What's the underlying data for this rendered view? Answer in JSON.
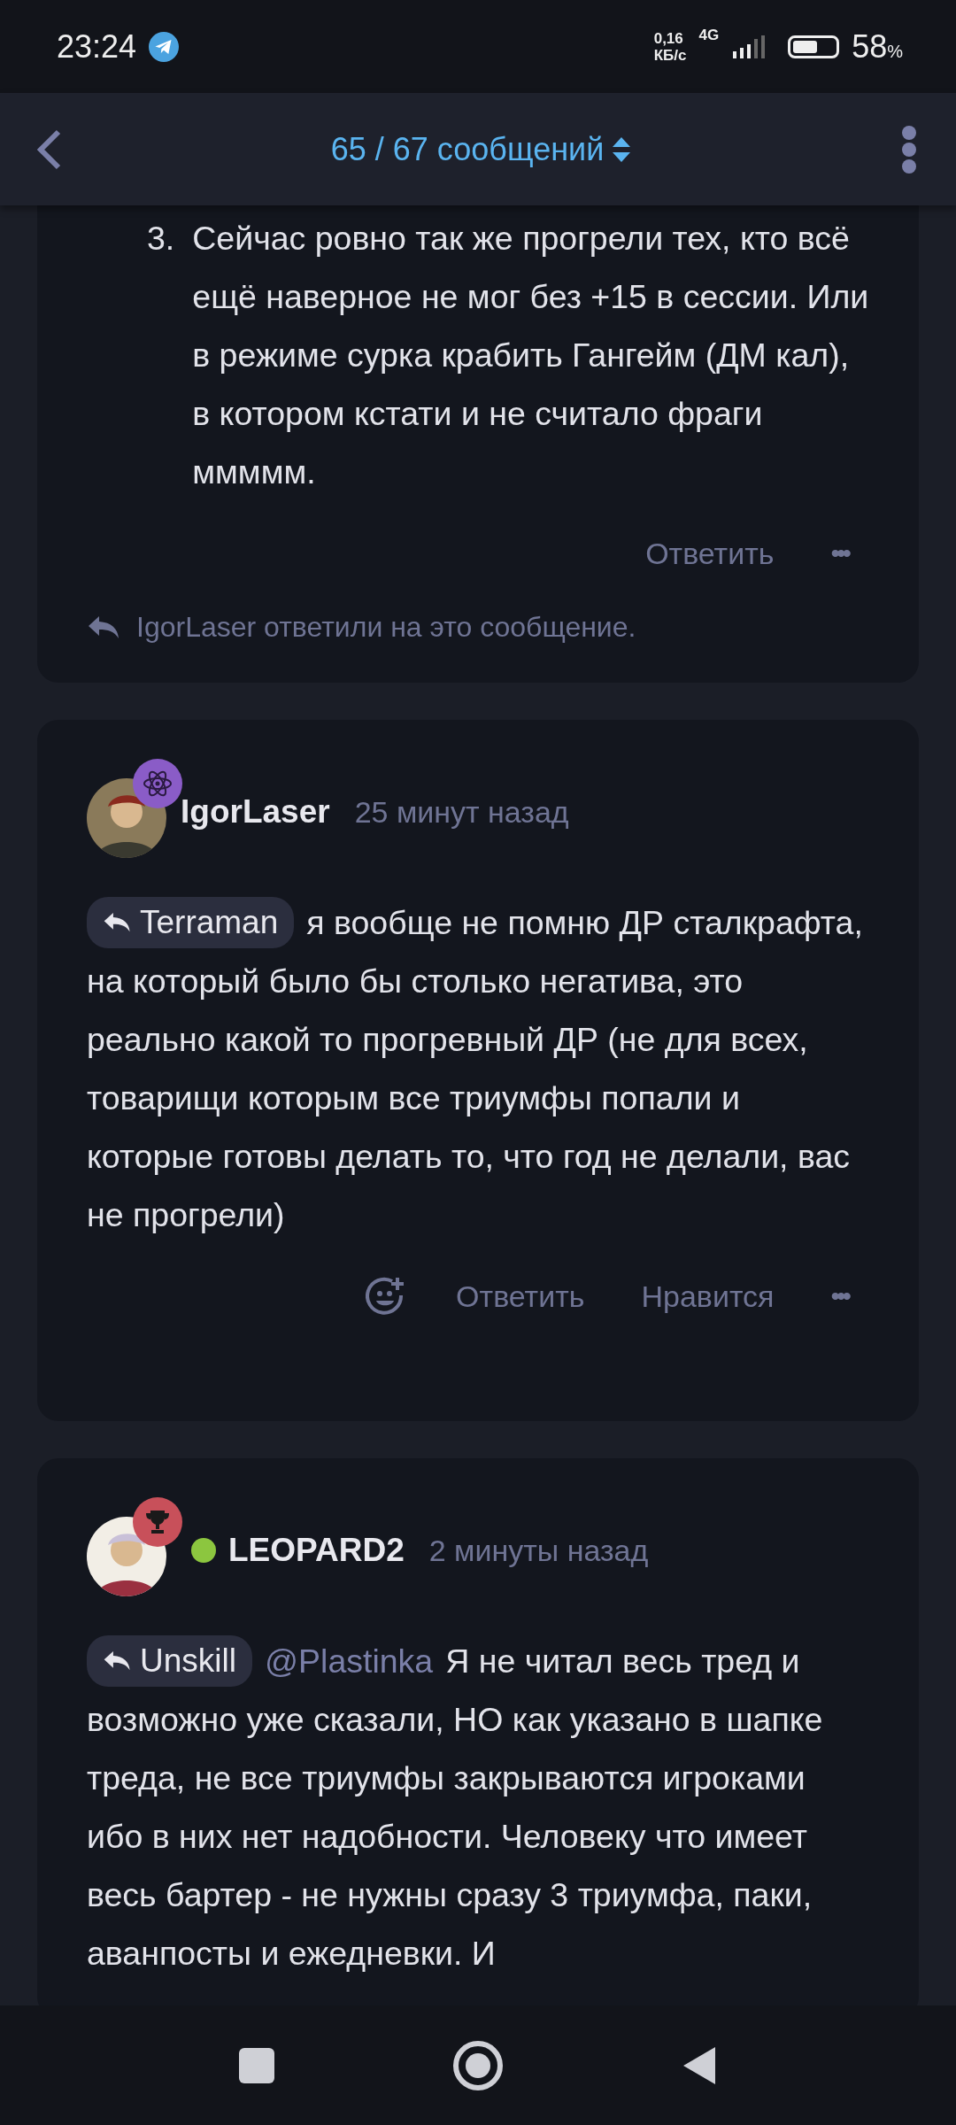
{
  "status_bar": {
    "time": "23:24",
    "speed": "0,16",
    "speed_unit": "КБ/с",
    "network": "4G",
    "battery_percent": "58",
    "battery_unit": "%"
  },
  "header": {
    "title": "65 / 67 сообщений"
  },
  "posts": [
    {
      "kind": "partial",
      "list_number": "3.",
      "text": "Сейчас ровно так же прогрели тех, кто всё ещё наверное не мог без +15 в сессии. Или в режиме сурка крабить Гангейм (ДМ кал), в котором кстати и не считало фраги ммммм.",
      "actions": [
        {
          "kind": "reply",
          "label": "Ответить"
        },
        {
          "kind": "more",
          "label": "•••"
        }
      ],
      "replied_note": "IgorLaser ответили на это сообщение."
    },
    {
      "kind": "full",
      "author": "IgorLaser",
      "badge": {
        "kind": "atom"
      },
      "online": false,
      "time": "25 минут назад",
      "quote": "Terraman",
      "text": "я вообще не помню ДР сталкрафта, на который было бы столько негатива, это реально какой то прогревный ДР (не для всех, товарищи которым все триумфы попали и которые готовы делать то, что год не делали, вас не прогрели)",
      "actions": [
        {
          "kind": "react"
        },
        {
          "kind": "reply",
          "label": "Ответить"
        },
        {
          "kind": "like",
          "label": "Нравится"
        },
        {
          "kind": "more",
          "label": "•••"
        }
      ]
    },
    {
      "kind": "full",
      "author": "LEOPARD2",
      "badge": {
        "kind": "trophy"
      },
      "online": true,
      "time": "2 минуты назад",
      "quote": "Unskill",
      "mention": "@Plastinka",
      "text": "Я не читал весь тред и возможно уже сказали, НО как указано в шапке треда, не все триумфы закрываются игроками ибо в них нет надобности. Человеку что имеет весь бартер - не нужны сразу 3 триумфа, паки, аванпосты и ежедневки. И"
    }
  ]
}
